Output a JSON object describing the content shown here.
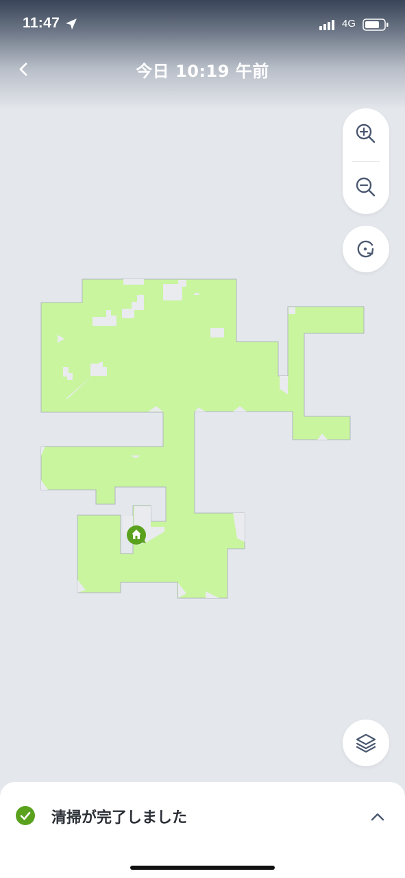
{
  "status_bar": {
    "time": "11:47",
    "network": "4G",
    "icons": [
      "location-arrow-icon",
      "cellular-signal-icon",
      "battery-icon"
    ]
  },
  "header": {
    "title": "今日 10:19 午前",
    "back_icon": "chevron-left-icon"
  },
  "map_controls": {
    "zoom_in_icon": "zoom-in-icon",
    "zoom_out_icon": "zoom-out-icon",
    "rotate_icon": "rotate-icon",
    "layers_icon": "layers-icon"
  },
  "map": {
    "cleaned_color": "#c8f59e",
    "dock_icon": "home-icon",
    "dock_color": "#5aa11e"
  },
  "bottom_sheet": {
    "status_text": "清掃が完了しました",
    "status_icon": "check-circle-icon",
    "status_color": "#5aa11e",
    "expand_icon": "chevron-up-icon"
  }
}
